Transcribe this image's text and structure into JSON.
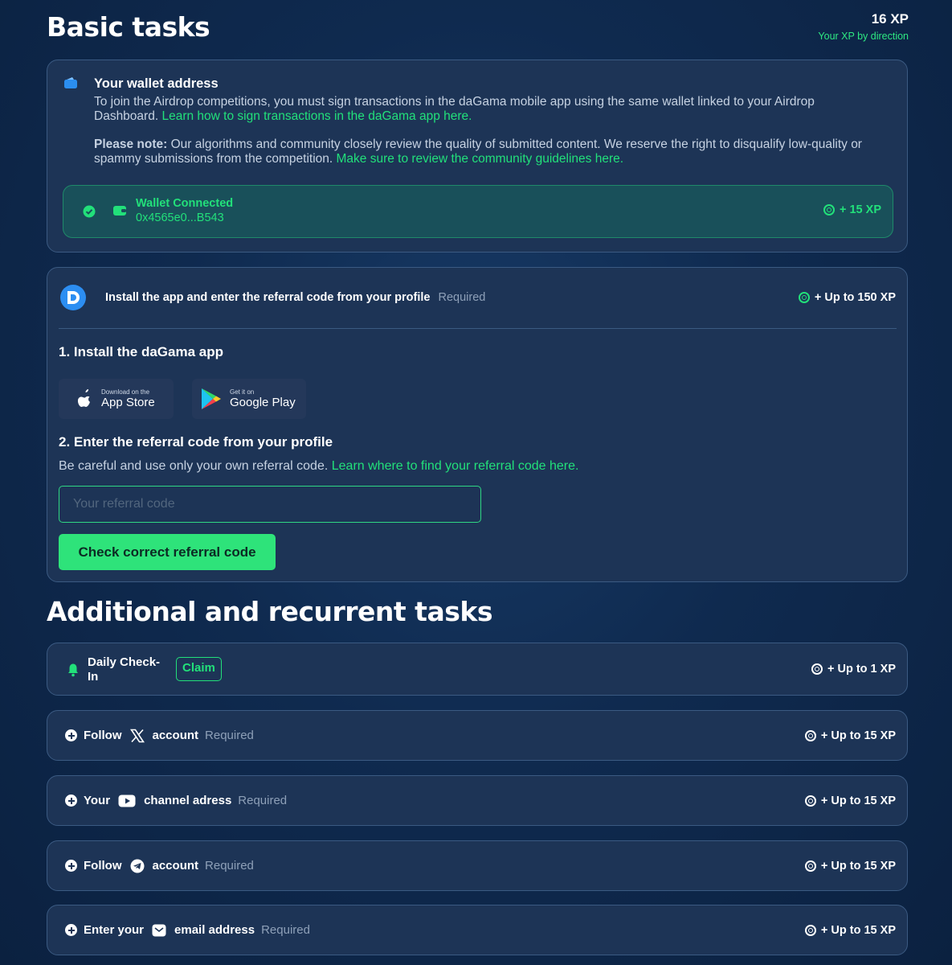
{
  "basic": {
    "title": "Basic tasks",
    "xp_total": "16 XP",
    "xp_by_direction": "Your XP by direction"
  },
  "wallet": {
    "title": "Your wallet address",
    "text": "To join the Airdrop competitions, you must sign transactions in the daGama mobile app using the same wallet linked to your Airdrop Dashboard.",
    "text_link": "Learn how to sign transactions in the daGama app here.",
    "note_label": "Please note:",
    "note_text": "Our algorithms and community closely review the quality of submitted content. We reserve the right to disqualify low-quality or spammy submissions from the competition.",
    "note_link": "Make sure to review the community guidelines here.",
    "connected_label": "Wallet Connected",
    "address": "0x4565e0...B543",
    "xp": "+ 15 XP"
  },
  "install": {
    "title": "Install the app and enter the referral code from your profile",
    "required": "Required",
    "xp": "+ Up to 150 XP",
    "step1": "1. Install the daGama app",
    "appstore_small": "Download on the",
    "appstore_big": "App Store",
    "googleplay_small": "Get it on",
    "googleplay_big": "Google Play",
    "step2": "2. Enter the referral code from your profile",
    "careful": "Be careful and use only your own referral code.",
    "careful_link": "Learn where to find your referral code here.",
    "input_placeholder": "Your referral code",
    "check_button": "Check correct referral code"
  },
  "additional": {
    "title": "Additional and recurrent tasks",
    "daily": {
      "label": "Daily Check-In",
      "claim": "Claim",
      "xp": "+ Up to 1 XP"
    },
    "tasks": [
      {
        "pre": "Follow",
        "icon": "x-logo-icon",
        "post": "account",
        "required": "Required",
        "xp": "+ Up to 15 XP"
      },
      {
        "pre": "Your",
        "icon": "youtube-icon",
        "post": "channel adress",
        "required": "Required",
        "xp": "+ Up to 15 XP"
      },
      {
        "pre": "Follow",
        "icon": "telegram-icon",
        "post": "account",
        "required": "Required",
        "xp": "+ Up to 15 XP"
      },
      {
        "pre": "Enter your",
        "icon": "email-icon",
        "post": "email address",
        "required": "Required",
        "xp": "+ Up to 15 XP"
      }
    ]
  },
  "colors": {
    "accent": "#2ee37a",
    "card_bg": "#1d3456",
    "card_border": "#3b5a82",
    "page_bg": "#0f2a4f"
  }
}
